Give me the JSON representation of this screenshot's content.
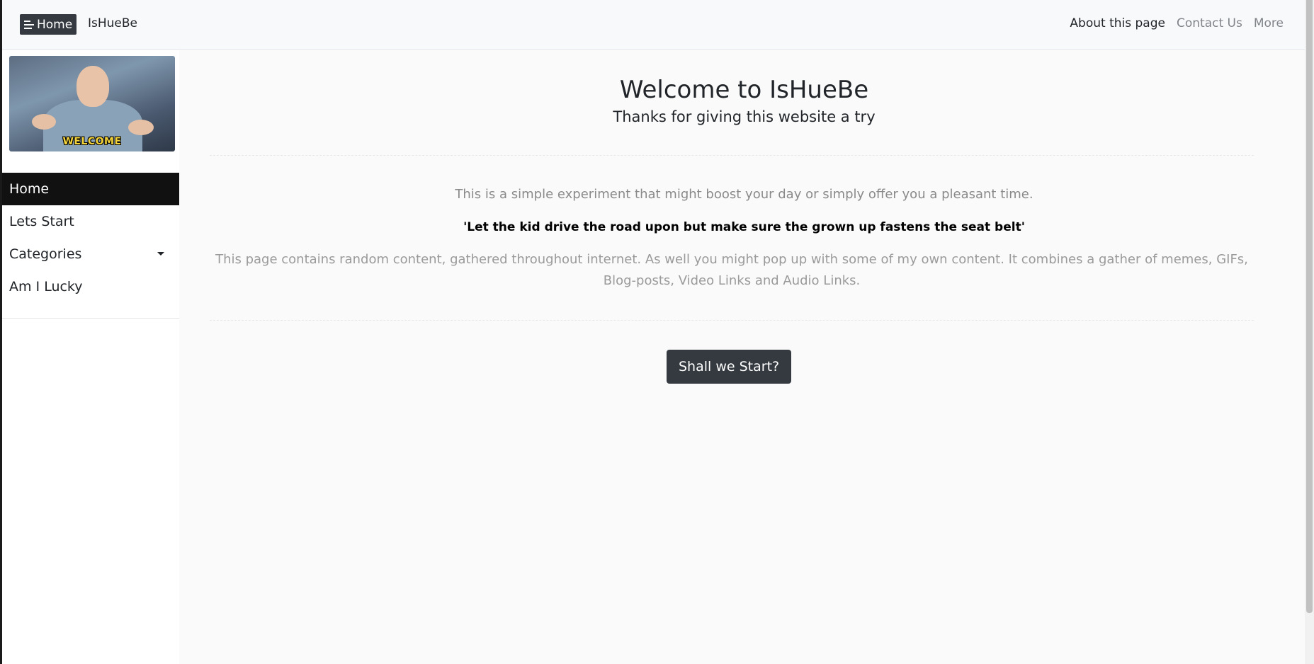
{
  "navbar": {
    "home_label": "Home",
    "brand": "IsHueBe",
    "links": [
      {
        "label": "About this page",
        "state": "active"
      },
      {
        "label": "Contact Us",
        "state": "muted"
      },
      {
        "label": "More",
        "state": "muted"
      }
    ]
  },
  "sidebar": {
    "image_caption": "WELCOME",
    "items": [
      {
        "label": "Home",
        "active": true
      },
      {
        "label": "Lets Start",
        "active": false
      },
      {
        "label": "Categories",
        "active": false,
        "has_dropdown": true
      },
      {
        "label": "Am I Lucky",
        "active": false
      }
    ]
  },
  "main": {
    "title": "Welcome to IsHueBe",
    "subtitle": "Thanks for giving this website a try",
    "intro": "This is a simple experiment that might boost your day or simply offer you a pleasant time.",
    "quote": "'Let the kid drive the road upon but make sure the grown up fastens the seat belt'",
    "description": "This page contains random content, gathered throughout internet. As well you might pop up with some of my own content. It combines a gather of memes, GIFs, Blog-posts, Video Links and Audio Links.",
    "start_button": "Shall we Start?"
  },
  "colors": {
    "navbar_bg": "#f8f9fa",
    "dark_button": "#343a40",
    "sidebar_active": "#111111",
    "muted_text": "#8a8a8a",
    "caption_yellow": "#f4d43a"
  },
  "icons": {
    "menu": "menu-lines-icon",
    "dropdown": "caret-down-icon"
  }
}
